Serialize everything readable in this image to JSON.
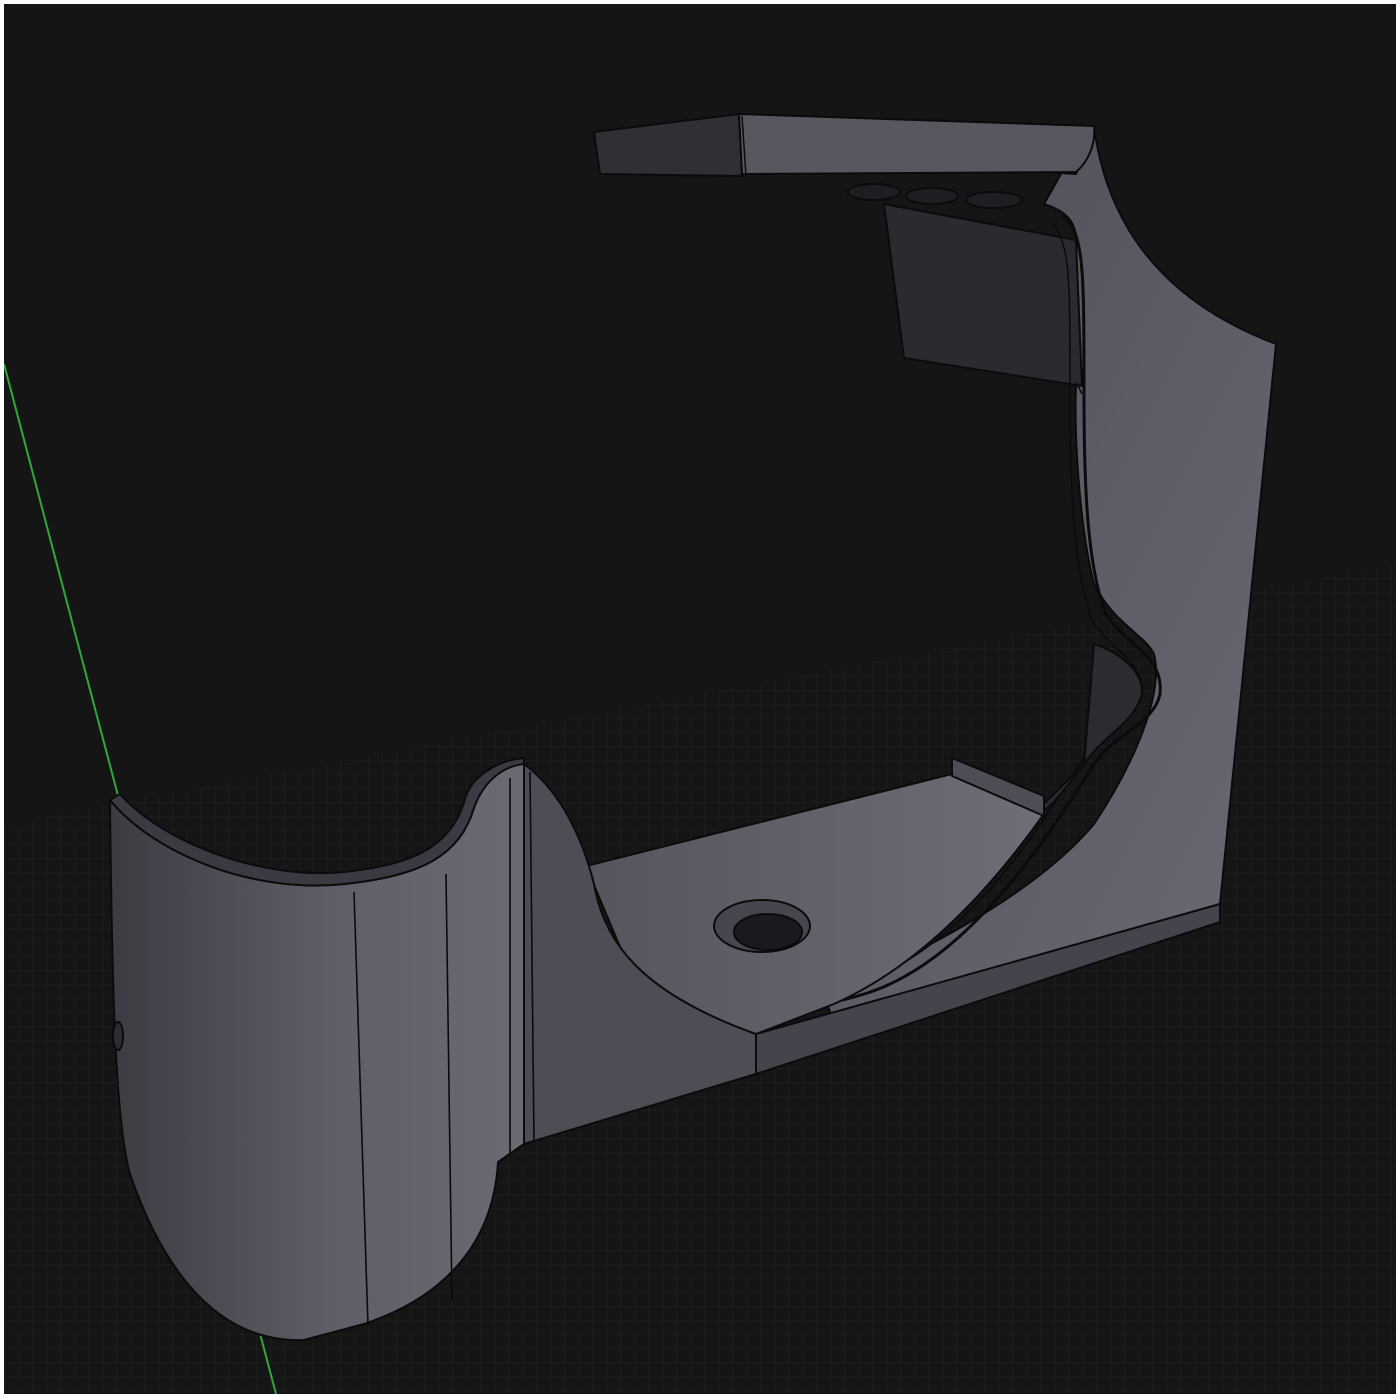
{
  "viewport": {
    "background": "#151515",
    "grid_color": "#3a3a3a",
    "axis_color": "#2fa83a",
    "model_body_color": "#5a5a64",
    "model_shadow_color": "#2c2c32",
    "model_highlight_color": "#77777f",
    "edge_color": "#0a0a0a"
  }
}
